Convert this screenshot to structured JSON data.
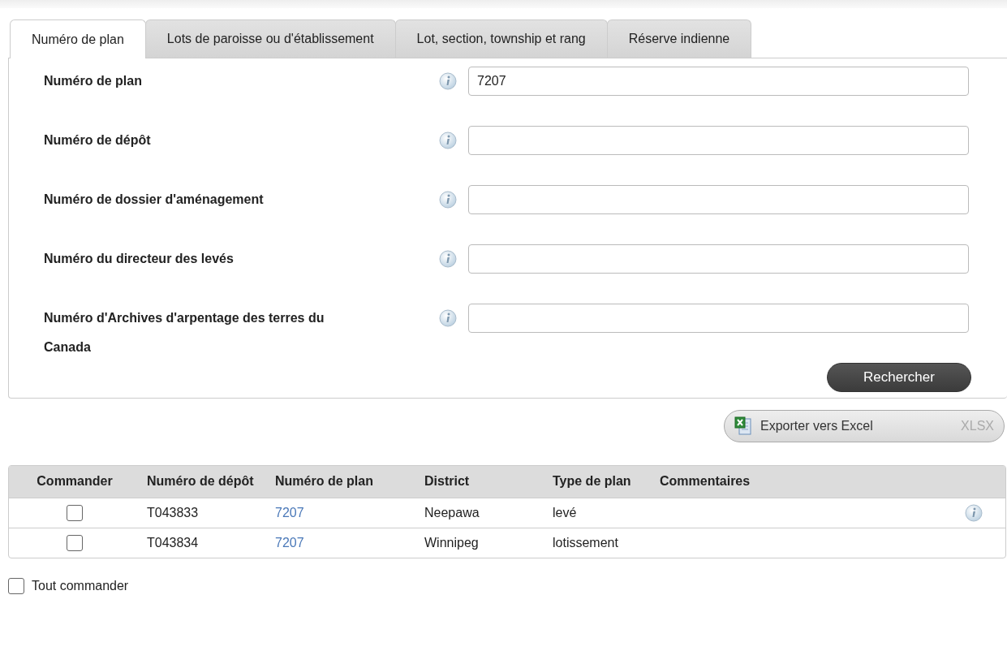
{
  "tabs": [
    {
      "label": "Numéro de plan",
      "selected": true
    },
    {
      "label": "Lots de paroisse ou d'établissement",
      "selected": false
    },
    {
      "label": "Lot, section, township et rang",
      "selected": false
    },
    {
      "label": "Réserve indienne",
      "selected": false
    }
  ],
  "form": {
    "fields": [
      {
        "label": "Numéro de plan",
        "value": "7207"
      },
      {
        "label": "Numéro de dépôt"
      },
      {
        "label": "Numéro de dossier d'aménagement"
      },
      {
        "label": "Numéro du directeur des levés"
      },
      {
        "label": "Numéro d'Archives d'arpentage des terres du Canada"
      }
    ],
    "search_button": "Rechercher"
  },
  "export": {
    "label": "Exporter vers Excel",
    "format": "XLSX"
  },
  "table": {
    "columns": [
      "Commander",
      "Numéro de dépôt",
      "Numéro de plan",
      "District",
      "Type de plan",
      "Commentaires"
    ],
    "rows": [
      {
        "checked": false,
        "depot": "T043833",
        "plan": "7207",
        "district": "Neepawa",
        "type": "levé",
        "info": true
      },
      {
        "checked": false,
        "depot": "T043834",
        "plan": "7207",
        "district": "Winnipeg",
        "type": "lotissement",
        "info": false
      }
    ]
  },
  "order_all": {
    "label": "Tout commander",
    "checked": false
  }
}
